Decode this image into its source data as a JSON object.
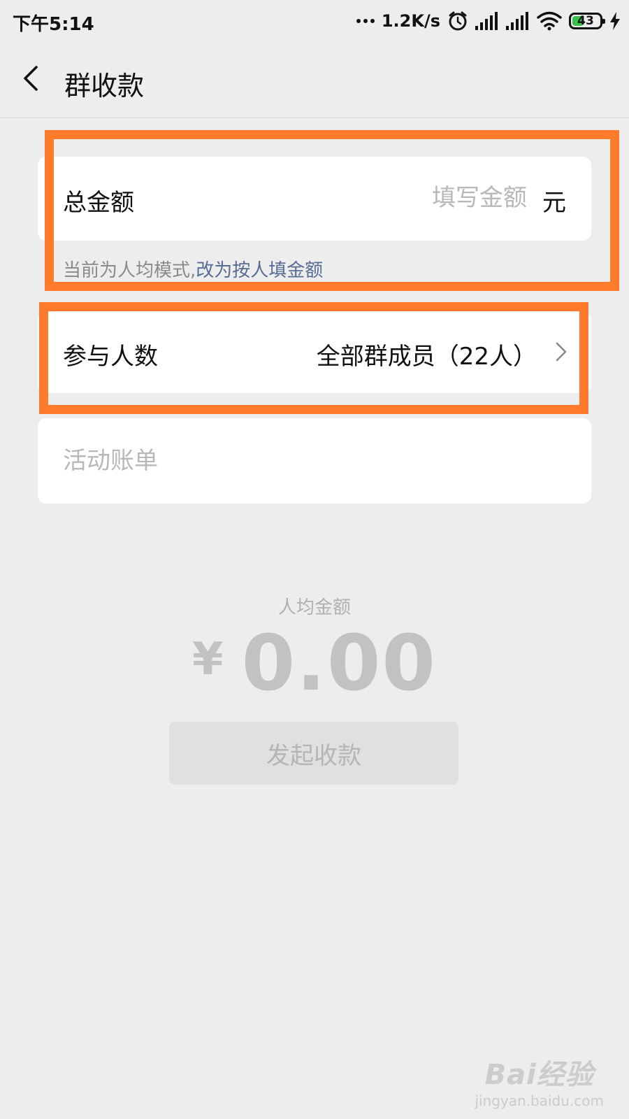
{
  "status_bar": {
    "time": "下午5:14",
    "net_speed": "1.2K/s",
    "battery": "43",
    "battery_level": 0.43
  },
  "header": {
    "title": "群收款"
  },
  "amount_row": {
    "label": "总金额",
    "placeholder": "填写金额",
    "unit": "元"
  },
  "mode_hint": {
    "text": "当前为人均模式,",
    "link": "改为按人填金额"
  },
  "people_row": {
    "label": "参与人数",
    "value": "全部群成员（22人）"
  },
  "bill_row": {
    "placeholder": "活动账单"
  },
  "summary": {
    "label": "人均金额",
    "currency": "¥",
    "amount": "0.00"
  },
  "submit_button": {
    "label": "发起收款"
  },
  "watermark": {
    "main": "Bai经验",
    "sub": "jingyan.baidu.com"
  },
  "colors": {
    "highlight": "#ff7a2a",
    "link": "#576b95",
    "background": "#ededed"
  }
}
